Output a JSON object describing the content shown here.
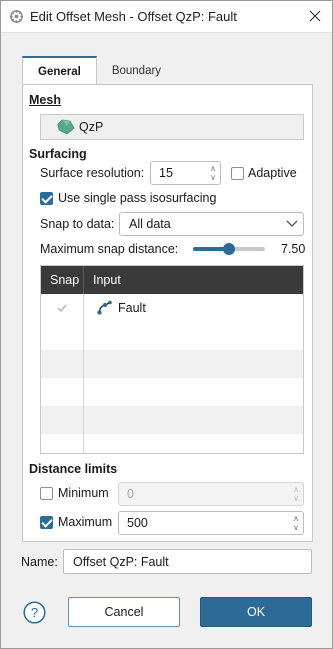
{
  "window": {
    "title": "Edit Offset Mesh - Offset QzP: Fault"
  },
  "tabs": [
    {
      "label": "General",
      "active": true
    },
    {
      "label": "Boundary",
      "active": false
    }
  ],
  "mesh": {
    "section_label": "Mesh",
    "value": "QzP",
    "icon_color": "#5aa88a"
  },
  "surfacing": {
    "section_label": "Surfacing",
    "resolution_label": "Surface resolution:",
    "resolution_value": "15",
    "adaptive_label": "Adaptive",
    "adaptive_checked": false,
    "single_pass_label": "Use single pass isosurfacing",
    "single_pass_checked": true,
    "snap_label": "Snap to data:",
    "snap_value": "All data",
    "max_snap_label": "Maximum snap distance:",
    "max_snap_value": "7.50",
    "max_snap_fraction": 0.5
  },
  "grid": {
    "col_snap": "Snap",
    "col_input": "Input",
    "rows": [
      {
        "snap_checked": true,
        "input": "Fault"
      },
      {
        "snap_checked": false,
        "input": ""
      },
      {
        "snap_checked": false,
        "input": ""
      },
      {
        "snap_checked": false,
        "input": ""
      },
      {
        "snap_checked": false,
        "input": ""
      },
      {
        "snap_checked": false,
        "input": ""
      }
    ]
  },
  "distance_limits": {
    "section_label": "Distance limits",
    "minimum_label": "Minimum",
    "minimum_checked": false,
    "minimum_value": "0",
    "maximum_label": "Maximum",
    "maximum_checked": true,
    "maximum_value": "500"
  },
  "name": {
    "label": "Name:",
    "value": "Offset QzP: Fault"
  },
  "buttons": {
    "cancel": "Cancel",
    "ok": "OK"
  },
  "colors": {
    "accent": "#2d6a96",
    "grid_header": "#3a3a3a"
  }
}
